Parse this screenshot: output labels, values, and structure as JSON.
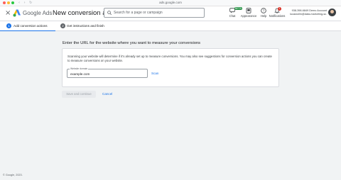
{
  "browser": {
    "url": "ads.google.com"
  },
  "header": {
    "brand": "Google Ads",
    "page_title": "New conversion action",
    "search_placeholder": "Search for a page or campaign",
    "actions": [
      {
        "label": "Chat",
        "icon": "chat-icon",
        "badge": "BETA"
      },
      {
        "label": "Appearance",
        "icon": "appearance-icon"
      },
      {
        "label": "Help",
        "icon": "help-icon"
      },
      {
        "label": "Notifications",
        "icon": "bell-icon",
        "badge": "1"
      }
    ],
    "account": {
      "line1": "938-398-6849 Demo Account",
      "line2": "lucasrollin@data-marketing-sc..."
    }
  },
  "stepper": {
    "steps": [
      {
        "number": "1",
        "label": "Add conversion actions",
        "active": true
      },
      {
        "number": "2",
        "label": "Get instructions and finish",
        "active": false
      }
    ]
  },
  "main": {
    "heading": "Enter the URL for the website where you want to measure your conversions",
    "description": "Scanning your website will determine if it's already set up to measure conversions. You may also see suggestions for conversion actions you can create to measure conversions on your website.",
    "domain_label": "Website domain",
    "domain_value": "example.com",
    "scan_label": "Scan",
    "save_label": "Save and continue",
    "cancel_label": "Cancel"
  },
  "footer": {
    "copyright": "© Google, 2023."
  },
  "colors": {
    "accent": "#1a73e8",
    "background": "#f1f3f4",
    "notification_badge": "#d93025",
    "beta_badge": "#1e8e3e"
  }
}
